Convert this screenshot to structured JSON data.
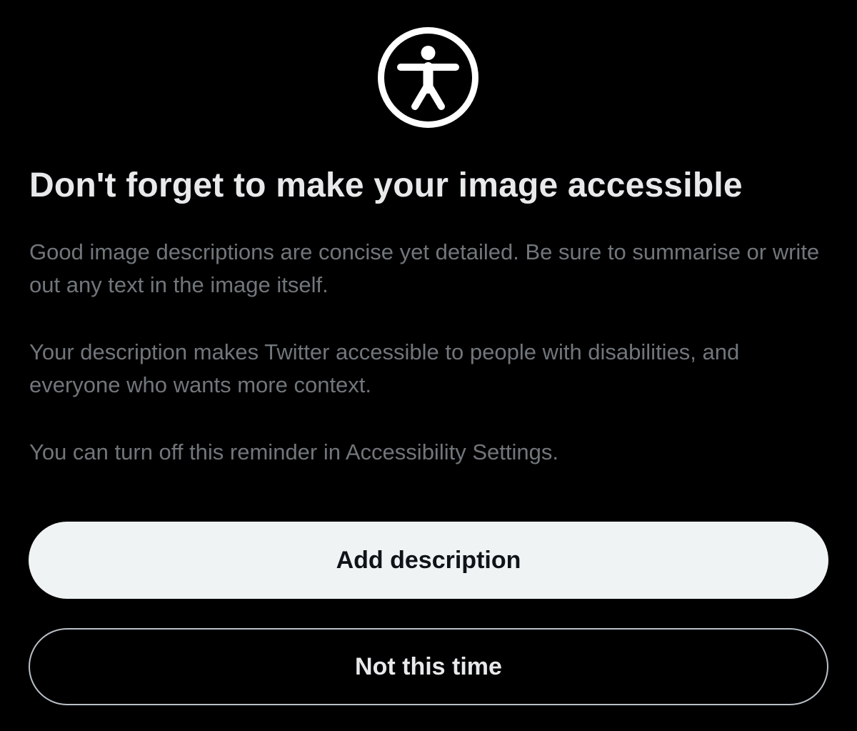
{
  "dialog": {
    "icon": "accessibility-icon",
    "title": "Don't forget to make your image accessible",
    "paragraphs": [
      "Good image descriptions are concise yet detailed. Be sure to summarise or write out any text in the image itself.",
      "Your description makes Twitter accessible to people with disabilities, and everyone who wants more context.",
      "You can turn off this reminder in Accessibility Settings."
    ],
    "primary_button": "Add description",
    "secondary_button": "Not this time"
  },
  "colors": {
    "background": "#000000",
    "title": "#e7e9ea",
    "body_text": "#71767b",
    "primary_button_bg": "#eff3f4",
    "primary_button_text": "#0f1419",
    "secondary_button_border": "#b9c0c7"
  }
}
